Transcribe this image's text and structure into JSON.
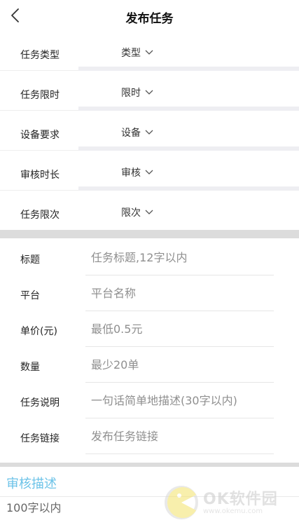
{
  "header": {
    "title": "发布任务"
  },
  "selects": [
    {
      "label": "任务类型",
      "value": "类型"
    },
    {
      "label": "任务限时",
      "value": "限时"
    },
    {
      "label": "设备要求",
      "value": "设备"
    },
    {
      "label": "审核时长",
      "value": "审核"
    },
    {
      "label": "任务限次",
      "value": "限次"
    }
  ],
  "inputs": [
    {
      "label": "标题",
      "placeholder": "任务标题,12字以内"
    },
    {
      "label": "平台",
      "placeholder": "平台名称"
    },
    {
      "label": "单价(元)",
      "placeholder": "最低0.5元"
    },
    {
      "label": "数量",
      "placeholder": "最少20单"
    },
    {
      "label": "任务说明",
      "placeholder": "一句话简单地描述(30字以内)"
    },
    {
      "label": "任务链接",
      "placeholder": "发布任务链接"
    }
  ],
  "review": {
    "title": "审核描述",
    "placeholder": "100字以内"
  },
  "watermark": {
    "name": "OK软件园",
    "url": "www.okemu.com"
  },
  "colors": {
    "accent": "#6cc3e8",
    "separator": "#dcdcdc",
    "placeholder": "#8f8f8f"
  },
  "icons": {
    "back": "chevron-left-icon",
    "dropdown": "chevron-down-icon"
  }
}
